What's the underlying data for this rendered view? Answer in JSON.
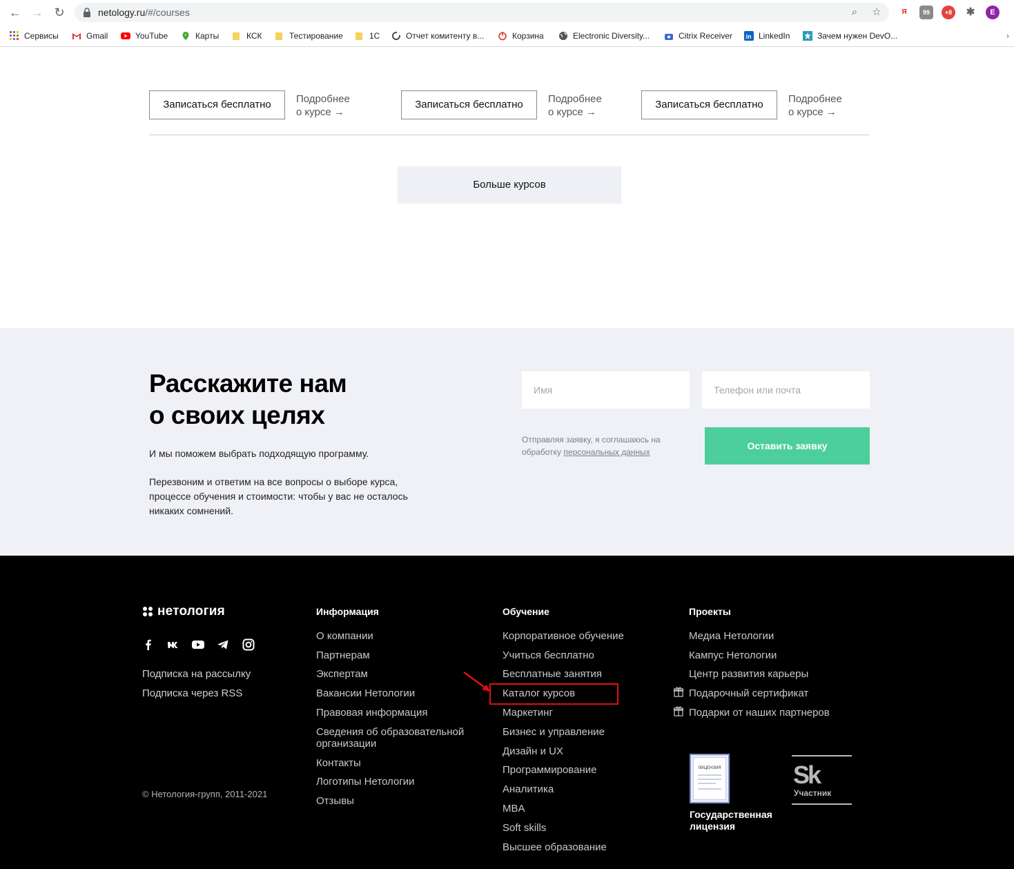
{
  "browser": {
    "url_domain": "netology.ru",
    "url_path": "/#/courses",
    "profile_initial": "E",
    "extensions": [
      "Я",
      "99",
      "+8"
    ],
    "bookmarks": [
      {
        "label": "Сервисы",
        "icon": "apps-grid-icon"
      },
      {
        "label": "Gmail",
        "icon": "gmail-icon"
      },
      {
        "label": "YouTube",
        "icon": "youtube-icon"
      },
      {
        "label": "Карты",
        "icon": "maps-pin-icon"
      },
      {
        "label": "КСК",
        "icon": "folder-icon"
      },
      {
        "label": "Тестирование",
        "icon": "folder-icon"
      },
      {
        "label": "1С",
        "icon": "folder-icon"
      },
      {
        "label": "Отчет комитенту в...",
        "icon": "refresh-circle-icon"
      },
      {
        "label": "Корзина",
        "icon": "power-icon"
      },
      {
        "label": "Electronic Diversity...",
        "icon": "globe-icon"
      },
      {
        "label": "Citrix Receiver",
        "icon": "citrix-icon"
      },
      {
        "label": "LinkedIn",
        "icon": "linkedin-icon"
      },
      {
        "label": "Зачем нужен DevO...",
        "icon": "star-burst-icon"
      }
    ]
  },
  "courses": {
    "cards": [
      {
        "signup": "Записаться бесплатно",
        "more_line1": "Подробнее",
        "more_line2": "о курсе →"
      },
      {
        "signup": "Записаться бесплатно",
        "more_line1": "Подробнее",
        "more_line2": "о курсе →"
      },
      {
        "signup": "Записаться бесплатно",
        "more_line1": "Подробнее",
        "more_line2": "о курсе →"
      }
    ],
    "more_courses": "Больше курсов"
  },
  "goals": {
    "title_line1": "Расскажите нам",
    "title_line2": "о своих целях",
    "text1": "И мы поможем выбрать подходящую программу.",
    "text2": "Перезвоним и ответим на все вопросы о выборе курса, процессе обучения и стоимости: чтобы у вас не осталось никаких сомнений.",
    "name_placeholder": "Имя",
    "contact_placeholder": "Телефон или почта",
    "consent_text": "Отправляя заявку, я соглашаюсь на обработку ",
    "consent_link": "персональных данных",
    "submit": "Оставить заявку"
  },
  "footer": {
    "logo": "нетология",
    "socials": [
      "facebook-icon",
      "vk-icon",
      "youtube-icon",
      "telegram-icon",
      "instagram-icon"
    ],
    "subscriptions": [
      "Подписка на рассылку",
      "Подписка через RSS"
    ],
    "copyright": "© Нетология-групп, 2011-2021",
    "info_title": "Информация",
    "info_links": [
      "О компании",
      "Партнерам",
      "Экспертам",
      "Вакансии Нетологии",
      "Правовая информация",
      "Сведения об образовательной организации",
      "Контакты",
      "Логотипы Нетологии",
      "Отзывы"
    ],
    "learn_title": "Обучение",
    "learn_links": [
      "Корпоративное обучение",
      "Учиться бесплатно",
      "Бесплатные занятия",
      "Каталог курсов",
      "Маркетинг",
      "Бизнес и управление",
      "Дизайн и UX",
      "Программирование",
      "Аналитика",
      "MBA",
      "Soft skills",
      "Высшее образование"
    ],
    "projects_title": "Проекты",
    "projects_links": [
      "Медиа Нетологии",
      "Кампус Нетологии",
      "Центр развития карьеры",
      "Подарочный сертификат",
      "Подарки от наших партнеров"
    ],
    "license_badge": "ЛИЦЕНЗИЯ",
    "license_text": "Государственная лицензия",
    "sk_logo": "Sk",
    "sk_text": "Участник"
  },
  "annotation": {
    "highlight_color": "#e01010"
  }
}
